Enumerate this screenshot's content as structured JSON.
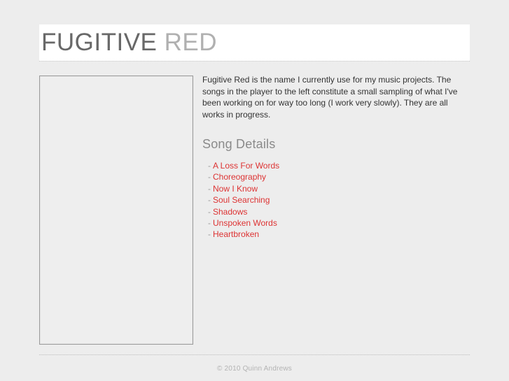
{
  "site": {
    "title_main": "FUGITIVE",
    "title_accent": "RED"
  },
  "player": {
    "region_label": ""
  },
  "main": {
    "intro": "Fugitive Red is the name I currently use for my music projects. The songs in the player to the left constitute a small sampling of what I've been working on for way too long (I work very slowly). They are all works in progress.",
    "songs_heading": "Song Details",
    "dash": "-",
    "songs": [
      {
        "title": "A Loss For Words"
      },
      {
        "title": "Choreography"
      },
      {
        "title": "Now I Know"
      },
      {
        "title": "Soul Searching"
      },
      {
        "title": "Shadows"
      },
      {
        "title": "Unspoken Words"
      },
      {
        "title": "Heartbroken"
      }
    ]
  },
  "footer": {
    "copyright": "© 2010 Quinn Andrews"
  },
  "colors": {
    "page_background": "#ededed",
    "header_background": "#ffffff",
    "title_main": "#686868",
    "title_accent": "#b0b0b0",
    "link_red": "#dd3333",
    "heading_gray": "#8a8a8a",
    "body_text": "#333333",
    "footer_text": "#b3b3b3",
    "box_border": "#9a9a9a"
  }
}
